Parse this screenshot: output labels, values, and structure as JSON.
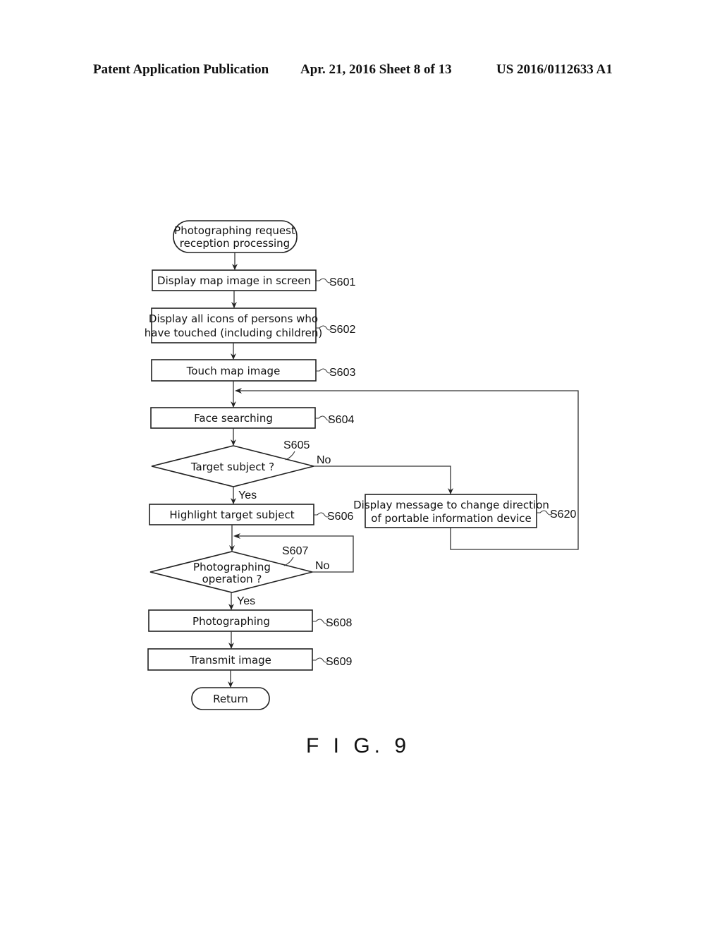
{
  "header": {
    "left": "Patent Application Publication",
    "middle": "Apr. 21, 2016  Sheet 8 of 13",
    "right": "US 2016/0112633 A1"
  },
  "flowchart": {
    "start": {
      "lines": [
        "Photographing request",
        "reception processing"
      ]
    },
    "steps": {
      "s601": {
        "id": "S601",
        "lines": [
          "Display map image in screen"
        ]
      },
      "s602": {
        "id": "S602",
        "lines": [
          "Display all icons of persons who",
          "have touched (including children)"
        ]
      },
      "s603": {
        "id": "S603",
        "lines": [
          "Touch map image"
        ]
      },
      "s604": {
        "id": "S604",
        "lines": [
          "Face searching"
        ]
      },
      "s605": {
        "id": "S605",
        "lines": [
          "Target subject ?"
        ],
        "yes": "Yes",
        "no": "No"
      },
      "s606": {
        "id": "S606",
        "lines": [
          "Highlight target subject"
        ]
      },
      "s607": {
        "id": "S607",
        "lines": [
          "Photographing",
          "operation ?"
        ],
        "yes": "Yes",
        "no": "No"
      },
      "s608": {
        "id": "S608",
        "lines": [
          "Photographing"
        ]
      },
      "s609": {
        "id": "S609",
        "lines": [
          "Transmit image"
        ]
      },
      "s620": {
        "id": "S620",
        "lines": [
          "Display message to change direction",
          "of portable information device"
        ]
      }
    },
    "end": {
      "lines": [
        "Return"
      ]
    }
  },
  "figure_label": "F I G. 9"
}
